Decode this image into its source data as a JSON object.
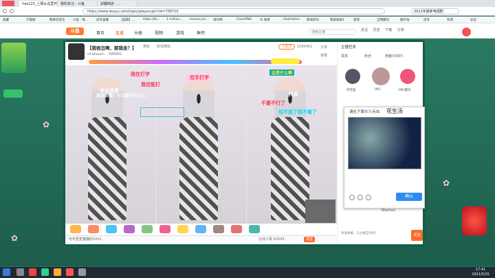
{
  "browser": {
    "tabs": [
      "hao123_上网从这里开始",
      "我的关注 - 斗鱼",
      "武器商店 - ..."
    ],
    "url": "https://www.douyu.com/topic/playaccpk?rid=708710",
    "bookmarks": [
      "收藏",
      "万能搜",
      "网易云音乐",
      "斗鱼 - 每...",
      "虎牙直播",
      "【蓝鲸】...",
      "https://br...",
      "1 million...",
      "human pic...",
      "海外网",
      "CleanPNG",
      "AI 搜索",
      "Illustration",
      "新闻资讯",
      "我爱收留1",
      "游戏",
      "全网最热",
      "图片站",
      "虎牙",
      "有道",
      "必应"
    ],
    "search_top": "2021年最新电视剧"
  },
  "site": {
    "logo": "斗鱼",
    "nav": [
      "首页",
      "直播",
      "分类",
      "视频",
      "游戏",
      "鱼吧"
    ],
    "search_placeholder": "搜索主播",
    "right_labels": [
      "关注",
      "历史",
      "下载",
      "分享"
    ]
  },
  "room": {
    "title": "【我很丑啊，那我走？】",
    "streamer": "rmoliaxen",
    "views": "586882",
    "tags": [
      "舞蹈",
      "颜值舞蹈"
    ],
    "follow": "+关注",
    "fans": "1580462",
    "share": "分享",
    "report": "举报"
  },
  "danmu": [
    {
      "text": "来说说看",
      "color": "#ffffff"
    },
    {
      "text": "我在打字",
      "color": "#ff3355"
    },
    {
      "text": "双手打字",
      "color": "#ff3355"
    },
    {
      "text": "我还能打",
      "color": "#ff3355"
    },
    {
      "text": "来说说看？什么都不么什么",
      "color": "#ffffff"
    },
    {
      "text": "抖音",
      "color": "#ffffff"
    },
    {
      "text": "不要不行了",
      "color": "#ff3355"
    },
    {
      "text": "知不道了我不看了",
      "color": "#00e0ff"
    },
    {
      "text": "这是什么啊",
      "color": "#ffeb3b"
    }
  ],
  "gifts": [
    "荧光棒",
    "办卡",
    "飞机",
    "火箭",
    "超级火箭",
    "告白气球",
    "动物",
    "宝箱",
    "鱼丸",
    "鲜花",
    "爱心"
  ],
  "chat": {
    "placeholder": "可可爱爱猫猫的1001",
    "online": "在线人数 82699",
    "send": "发送"
  },
  "side": {
    "title": "主播任务",
    "tabs": [
      "贵宾",
      "粉丝",
      "贡献(5587)"
    ],
    "rank_names": [
      "乔克里",
      "IMG",
      "IMG繁华"
    ],
    "captcha_title": "请在下面",
    "captcha_highlight": "依次",
    "captcha_tail": "点击:",
    "captcha_word": "花生汤",
    "confirm": "确认",
    "chat_hint": "发送弹幕，与主播互动吧！",
    "send": "发送",
    "user": "Manhun"
  },
  "taskbar": {
    "time": "17:41",
    "date": "2021/5/25"
  }
}
